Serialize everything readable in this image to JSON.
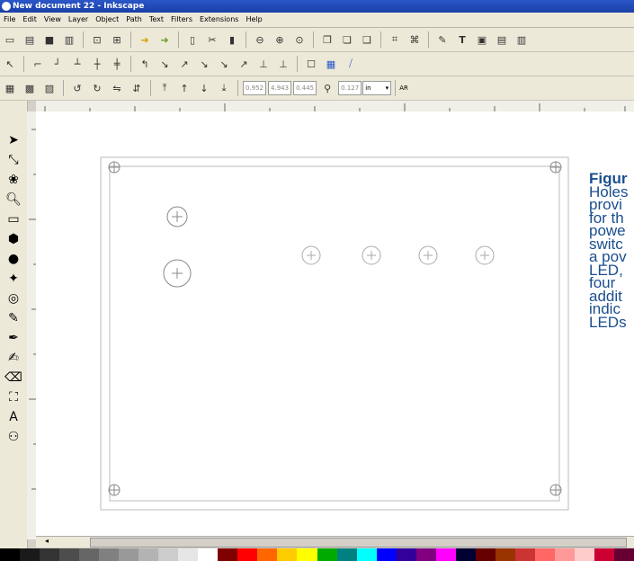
{
  "window": {
    "title": "New document 22 - Inkscape"
  },
  "menu": [
    "File",
    "Edit",
    "View",
    "Layer",
    "Object",
    "Path",
    "Text",
    "Filters",
    "Extensions",
    "Help"
  ],
  "toolbar": {
    "x_value": "0.952",
    "y_value": "4.943",
    "w_value": "0.445",
    "h_value": "0.127",
    "unit": "in",
    "overflow_label": "AR"
  },
  "tools": [
    "selector",
    "node",
    "tweak",
    "zoom",
    "rectangle",
    "3d-box",
    "ellipse",
    "star",
    "spiral",
    "pencil",
    "pen",
    "calligraphy",
    "eraser",
    "paint-bucket",
    "text",
    "connector"
  ],
  "caption": {
    "title": "Figur",
    "lines": [
      "Holes",
      "provi",
      "for th",
      "powe",
      "switc",
      "a pov",
      "LED,",
      "four",
      "addit",
      "indic",
      "LEDs"
    ]
  },
  "palette": [
    "#000000",
    "#1a1a1a",
    "#333333",
    "#4d4d4d",
    "#666666",
    "#808080",
    "#999999",
    "#b3b3b3",
    "#cccccc",
    "#e6e6e6",
    "#ffffff",
    "#800000",
    "#ff0000",
    "#ff6600",
    "#ffcc00",
    "#ffff00",
    "#00aa00",
    "#008080",
    "#00ffff",
    "#0000ff",
    "#330099",
    "#800080",
    "#ff00ff",
    "#000033",
    "#660000",
    "#993300",
    "#cc3333",
    "#ff6666",
    "#ff9999",
    "#ffcccc",
    "#cc0033",
    "#660033"
  ],
  "colors": {
    "caption": "#1a4e8f",
    "titlebar": "#1a3fa6"
  }
}
